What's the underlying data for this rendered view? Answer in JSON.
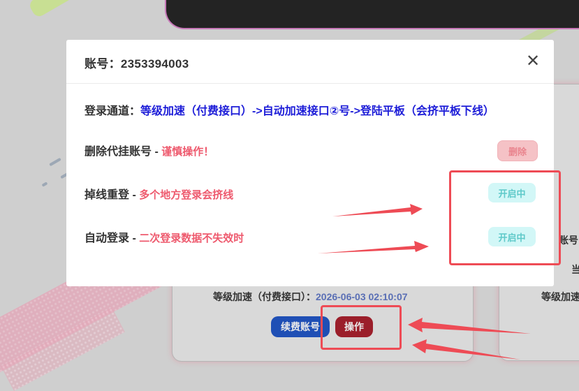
{
  "modal": {
    "title": "账号：2353394003",
    "close_icon": "close-icon",
    "login_channel": {
      "label": "登录通道：",
      "value": "等级加速（付费接口）->自动加速接口②号->登陆平板（会挤平板下线）"
    },
    "rows": [
      {
        "label": "删除代挂账号",
        "sep": " - ",
        "hint": "谨慎操作！",
        "button": "删除"
      },
      {
        "label": "掉线重登",
        "sep": " - ",
        "hint": "多个地方登录会挤线",
        "button": "开启中"
      },
      {
        "label": "自动登录",
        "sep": " - ",
        "hint": "二次登录数据不失效时",
        "button": "开启中"
      }
    ]
  },
  "background_card": {
    "expiry_label": "等级加速（付费接口）：",
    "expiry_value": "2026-06-03 02:10:07",
    "renew_button": "续费账号",
    "operate_button": "操作"
  },
  "right_card": {
    "line1": "账号",
    "line2": "当",
    "line3": "等级加速"
  },
  "colors": {
    "accent_blue": "#1d1dd8",
    "warning_red": "#ee5a6e",
    "annotation_red": "#ee4b55",
    "enabled_teal": "#5ec9c9"
  }
}
